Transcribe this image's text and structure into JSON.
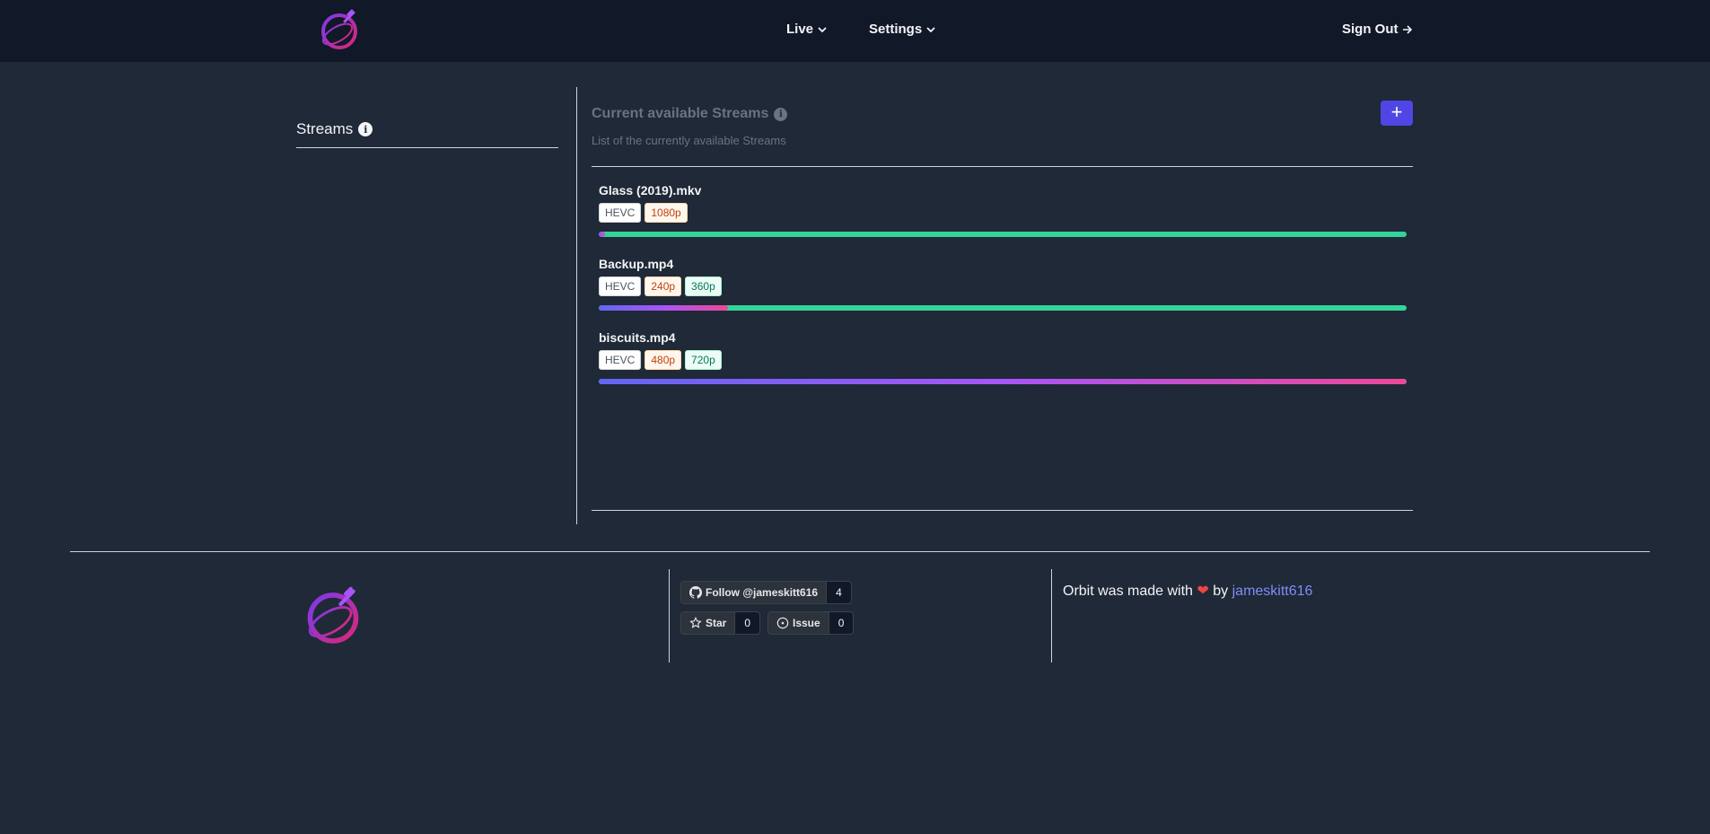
{
  "nav": {
    "live_label": "Live",
    "settings_label": "Settings",
    "signout_label": "Sign Out"
  },
  "sidebar": {
    "title": "Streams"
  },
  "main": {
    "title": "Current available Streams",
    "subtitle": "List of the currently available Streams",
    "add_button_label": "+"
  },
  "streams": [
    {
      "name": "Glass (2019).mkv",
      "badges": [
        "HEVC",
        "1080p"
      ],
      "progress": 0.008
    },
    {
      "name": "Backup.mp4",
      "badges": [
        "HEVC",
        "240p",
        "360p"
      ],
      "progress": 0.16
    },
    {
      "name": "biscuits.mp4",
      "badges": [
        "HEVC",
        "480p",
        "720p"
      ],
      "progress": 1.0
    }
  ],
  "footer": {
    "follow_label": "Follow @jameskitt616",
    "follow_count": "4",
    "star_label": "Star",
    "star_count": "0",
    "issue_label": "Issue",
    "issue_count": "0",
    "credit_prefix": "Orbit was made with",
    "credit_by": "by",
    "credit_author": "jameskitt616"
  },
  "colors": {
    "accent": "#4f46e5",
    "bar_complete": "#34d399",
    "bar_progress_start": "#6366f1",
    "bar_progress_end": "#ec4899",
    "heart": "#ef4444"
  }
}
